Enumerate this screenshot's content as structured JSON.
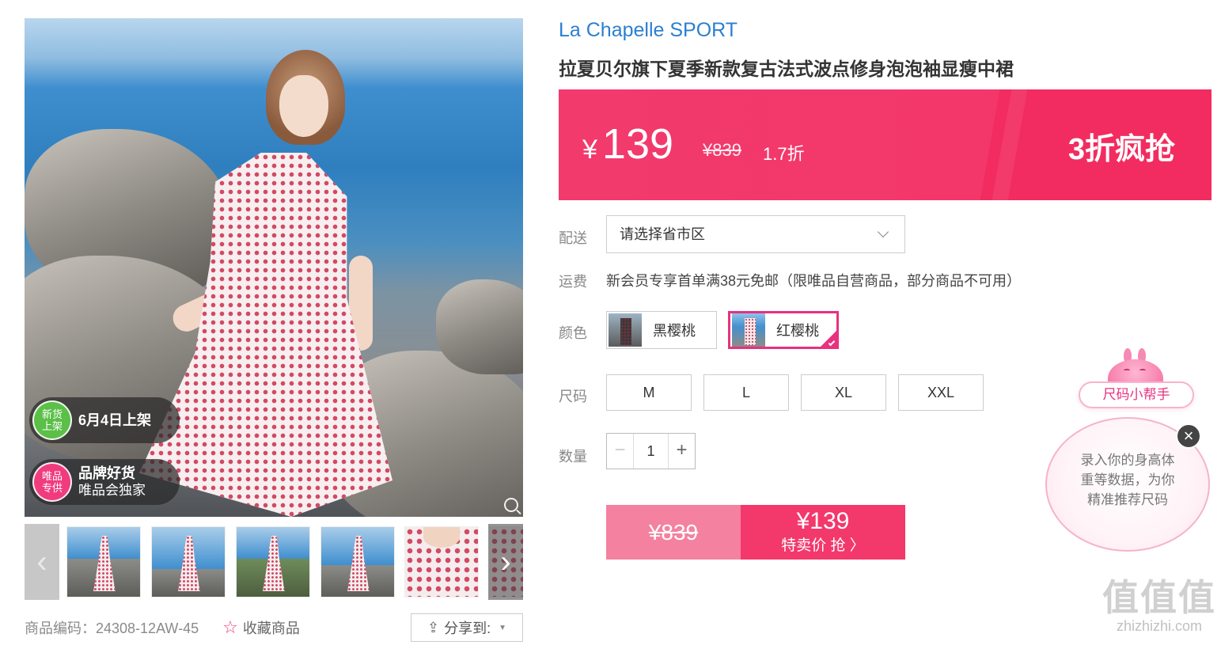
{
  "gallery": {
    "badges": {
      "new": {
        "circle_line1": "新货",
        "circle_line2": "上架",
        "text": "6月4日上架"
      },
      "brand": {
        "circle_line1": "唯品",
        "circle_line2": "专供",
        "text_line1": "品牌好货",
        "text_line2": "唯品会独家"
      }
    },
    "thumb_prev_icon": "chevron-left-icon",
    "thumb_next_icon": "chevron-right-icon",
    "thumb_count": 6
  },
  "meta": {
    "sku": "商品编码：24308-12AW-45",
    "favorite_label": "收藏商品",
    "share_label": "分享到:"
  },
  "product": {
    "brand": "La Chapelle SPORT",
    "title": "拉夏贝尔旗下夏季新款复古法式波点修身泡泡袖显瘦中裙"
  },
  "price": {
    "currency": "¥",
    "sale": "139",
    "original": "¥839",
    "discount": "1.7折",
    "promo": "3折疯抢"
  },
  "delivery": {
    "label": "配送",
    "select_value": "请选择省市区"
  },
  "freight": {
    "label": "运费",
    "text": "新会员专享首单满38元免邮（限唯品自营商品，部分商品不可用）"
  },
  "colors": {
    "label": "颜色",
    "options": [
      {
        "name": "黑樱桃",
        "selected": false
      },
      {
        "name": "红樱桃",
        "selected": true
      }
    ]
  },
  "sizes": {
    "label": "尺码",
    "options": [
      "M",
      "L",
      "XL",
      "XXL"
    ]
  },
  "quantity": {
    "label": "数量",
    "value": "1",
    "minus": "−",
    "plus": "+"
  },
  "buy": {
    "original": "¥839",
    "price": "¥139",
    "action": "特卖价 抢 〉"
  },
  "size_helper": {
    "tag": "尺码小帮手",
    "line1": "录入你的身高体",
    "line2": "重等数据，为你",
    "line3": "精准推荐尺码",
    "close": "×"
  },
  "watermark": {
    "big": "值值值",
    "small": "zhizhizhi.com"
  },
  "colors_theme": {
    "accent_pink": "#f3386c",
    "brand_blue": "#2b7fd0",
    "selected_border": "#e8317f"
  }
}
